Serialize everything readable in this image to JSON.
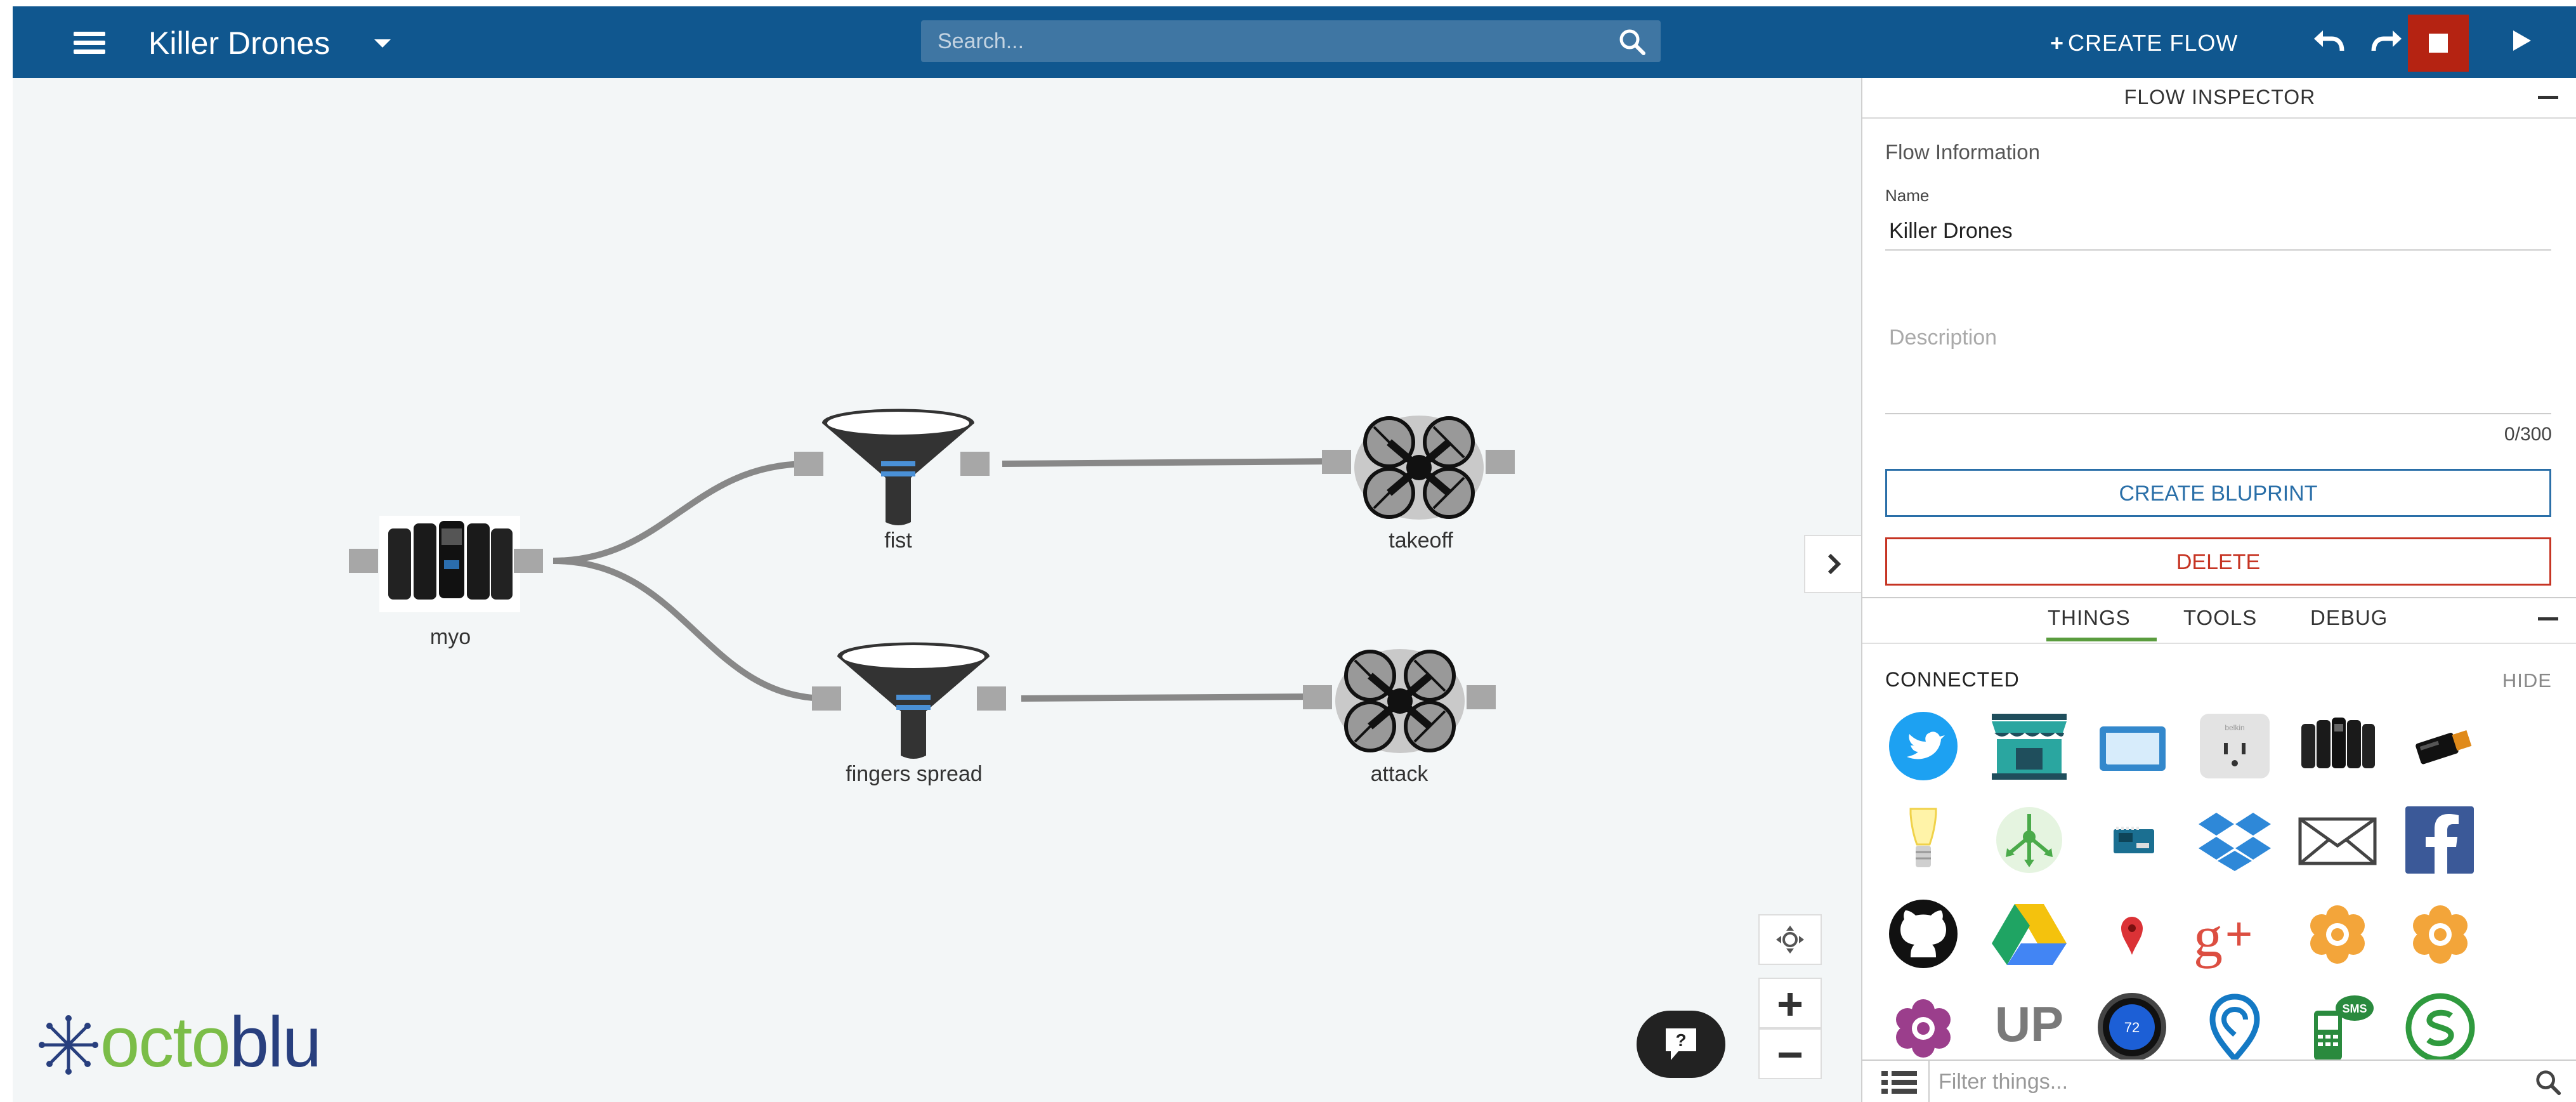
{
  "header": {
    "app_title": "Killer Drones",
    "search_placeholder": "Search...",
    "create_flow_label": "CREATE FLOW",
    "bg_color": "#10578f",
    "stop_color": "#b52312"
  },
  "canvas": {
    "nodes": [
      {
        "label": "myo",
        "icon": "myo-armband-icon"
      },
      {
        "label": "fist",
        "icon": "filter-funnel-icon"
      },
      {
        "label": "takeoff",
        "icon": "drone-icon"
      },
      {
        "label": "fingers spread",
        "icon": "filter-funnel-icon"
      },
      {
        "label": "attack",
        "icon": "drone-icon"
      }
    ],
    "logo": {
      "part1": "octo",
      "part2": "blu"
    }
  },
  "inspector": {
    "title": "FLOW INSPECTOR",
    "section": "Flow Information",
    "name_label": "Name",
    "name_value": "Killer Drones",
    "description_placeholder": "Description",
    "char_count": "0/300",
    "blueprint_button": "CREATE BLUPRINT",
    "delete_button": "DELETE",
    "tabs": [
      "THINGS",
      "TOOLS",
      "DEBUG"
    ],
    "active_tab": "THINGS",
    "connected_label": "CONNECTED",
    "hide_label": "HIDE",
    "things": [
      "twitter-icon",
      "storefront-icon",
      "chromecast-icon",
      "belkin-outlet-icon",
      "myo-armband-icon",
      "usb-dongle-icon",
      "light-bulb-icon",
      "hub-icon",
      "arduino-icon",
      "dropbox-icon",
      "email-icon",
      "facebook-icon",
      "github-icon",
      "google-drive-icon",
      "map-pin-icon",
      "google-plus-icon",
      "flower-icon",
      "flower-icon",
      "flower-purple-icon",
      "jawbone-up-icon",
      "nest-thermostat-icon",
      "location-icon",
      "sms-icon",
      "sphero-icon"
    ],
    "filter_placeholder": "Filter things...",
    "jawbone_text": "UP",
    "nest_value": "72",
    "sms_text": "SMS",
    "belkin_text": "belkin"
  }
}
